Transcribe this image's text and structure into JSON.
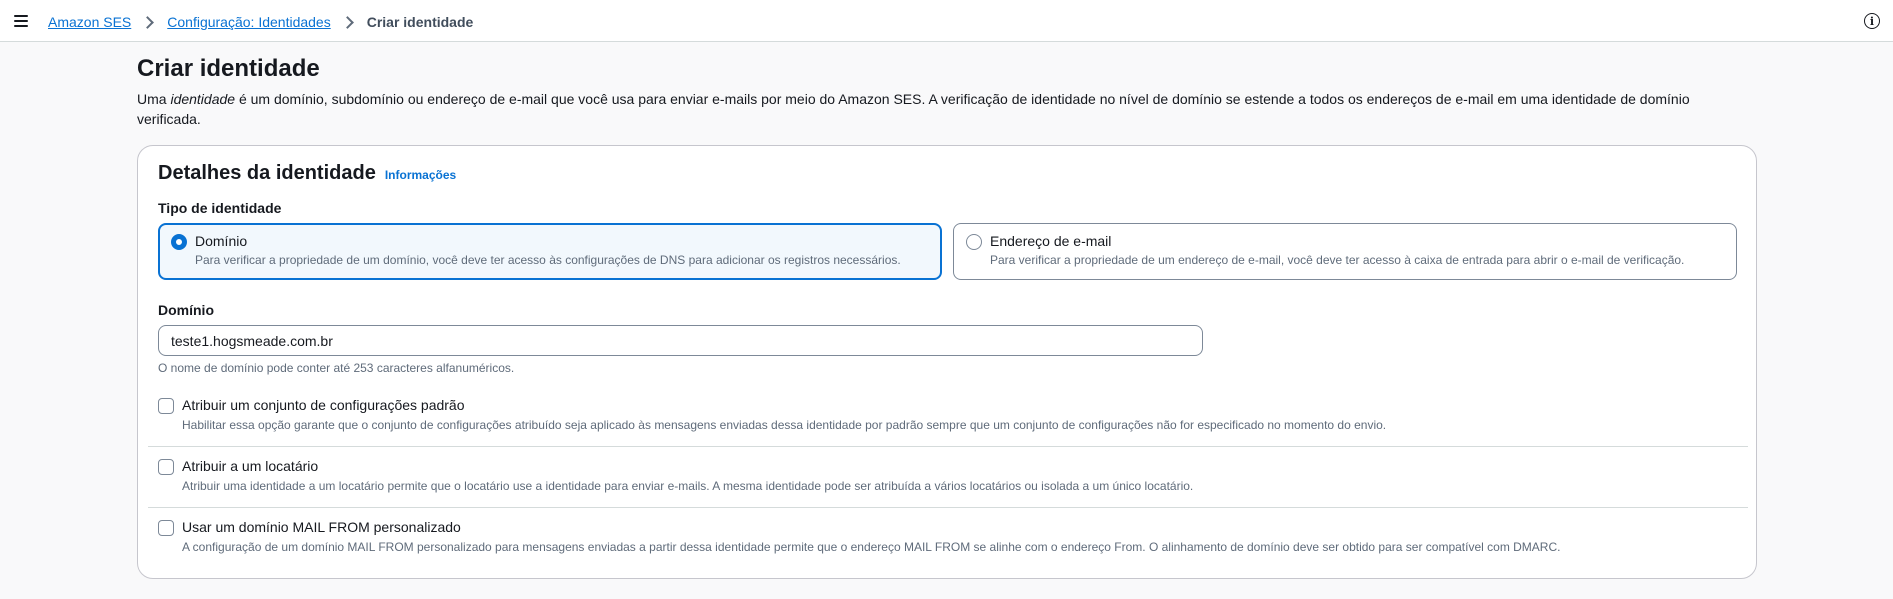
{
  "header": {
    "breadcrumb": [
      {
        "label": "Amazon SES"
      },
      {
        "label": "Configuração: Identidades"
      },
      {
        "label": "Criar identidade"
      }
    ]
  },
  "page": {
    "title": "Criar identidade",
    "desc_prefix": "Uma ",
    "desc_em": "identidade",
    "desc_suffix": " é um domínio, subdomínio ou endereço de e-mail que você usa para enviar e-mails por meio do Amazon SES. A verificação de identidade no nível de domínio se estende a todos os endereços de e-mail em uma identidade de domínio verificada."
  },
  "details": {
    "title": "Detalhes da identidade",
    "info_link": "Informações",
    "type_label": "Tipo de identidade",
    "options": [
      {
        "title": "Domínio",
        "desc": "Para verificar a propriedade de um domínio, você deve ter acesso às configurações de DNS para adicionar os registros necessários.",
        "selected": true
      },
      {
        "title": "Endereço de e-mail",
        "desc": "Para verificar a propriedade de um endereço de e-mail, você deve ter acesso à caixa de entrada para abrir o e-mail de verificação.",
        "selected": false
      }
    ],
    "domain_label": "Domínio",
    "domain_value": "teste1.hogsmeade.com.br",
    "domain_constraint": "O nome de domínio pode conter até 253 caracteres alfanuméricos.",
    "checkboxes": [
      {
        "title": "Atribuir um conjunto de configurações padrão",
        "desc": "Habilitar essa opção garante que o conjunto de configurações atribuído seja aplicado às mensagens enviadas dessa identidade por padrão sempre que um conjunto de configurações não for especificado no momento do envio.",
        "checked": false
      },
      {
        "title": "Atribuir a um locatário",
        "desc": "Atribuir uma identidade a um locatário permite que o locatário use a identidade para enviar e-mails. A mesma identidade pode ser atribuída a vários locatários ou isolada a um único locatário.",
        "checked": false
      },
      {
        "title": "Usar um domínio MAIL FROM personalizado",
        "desc": "A configuração de um domínio MAIL FROM personalizado para mensagens enviadas a partir dessa identidade permite que o endereço MAIL FROM se alinhe com o endereço From. O alinhamento de domínio deve ser obtido para ser compatível com DMARC.",
        "checked": false
      }
    ]
  },
  "colors": {
    "link": "#0972d3",
    "selected_tile_bg": "#f2f8fd",
    "text": "#16191f",
    "secondary_text": "#5f6b7a"
  }
}
